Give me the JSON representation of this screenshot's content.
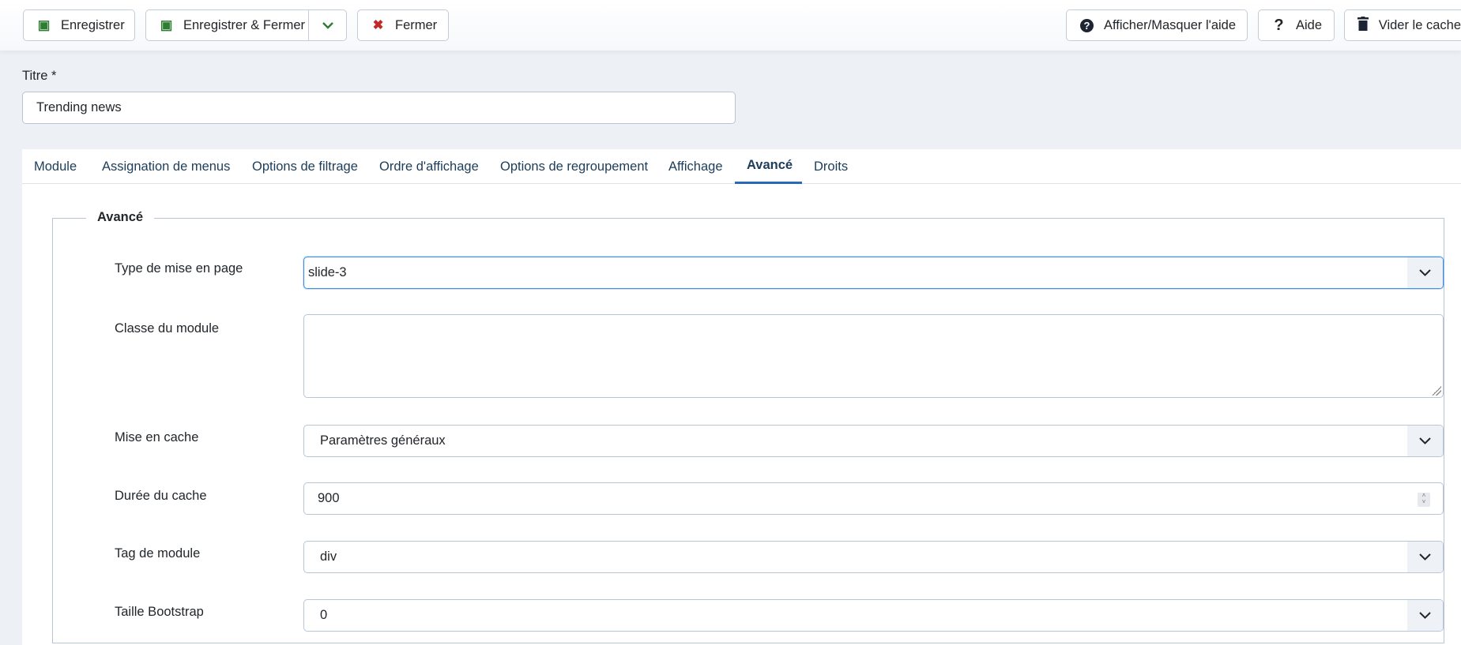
{
  "toolbar": {
    "save": {
      "label": "Enregistrer",
      "icon": "save-icon"
    },
    "save_close": {
      "label": "Enregistrer & Fermer",
      "icon": "save-icon"
    },
    "close": {
      "label": "Fermer",
      "icon": "close-icon"
    },
    "toggle_help": {
      "label": "Afficher/Masquer l'aide",
      "icon": "question-circle-icon"
    },
    "help": {
      "label": "Aide",
      "icon": "question-icon"
    },
    "clear_cache": {
      "label": "Vider le cache",
      "icon": "trash-icon"
    }
  },
  "title": {
    "label": "Titre *",
    "value": "Trending news"
  },
  "tabs": [
    {
      "label": "Module"
    },
    {
      "label": "Assignation de menus"
    },
    {
      "label": "Options de filtrage"
    },
    {
      "label": "Ordre d'affichage"
    },
    {
      "label": "Options de regroupement"
    },
    {
      "label": "Affichage"
    },
    {
      "label": "Avancé",
      "active": true
    },
    {
      "label": "Droits"
    }
  ],
  "fieldset": {
    "legend": "Avancé",
    "fields": [
      {
        "label": "Type de mise en page",
        "type": "select",
        "value": "slide-3"
      },
      {
        "label": "Classe du module",
        "type": "textarea",
        "value": ""
      },
      {
        "label": "Mise en cache",
        "type": "select",
        "value": "Paramètres généraux"
      },
      {
        "label": "Durée du cache",
        "type": "number",
        "value": "900"
      },
      {
        "label": "Tag de module",
        "type": "select",
        "value": "div"
      },
      {
        "label": "Taille Bootstrap",
        "type": "select",
        "value": "0"
      }
    ]
  },
  "colors": {
    "accent": "#2a69b8",
    "save_green": "#2f7d32",
    "close_red": "#c52827",
    "background": "#edf1f5"
  }
}
